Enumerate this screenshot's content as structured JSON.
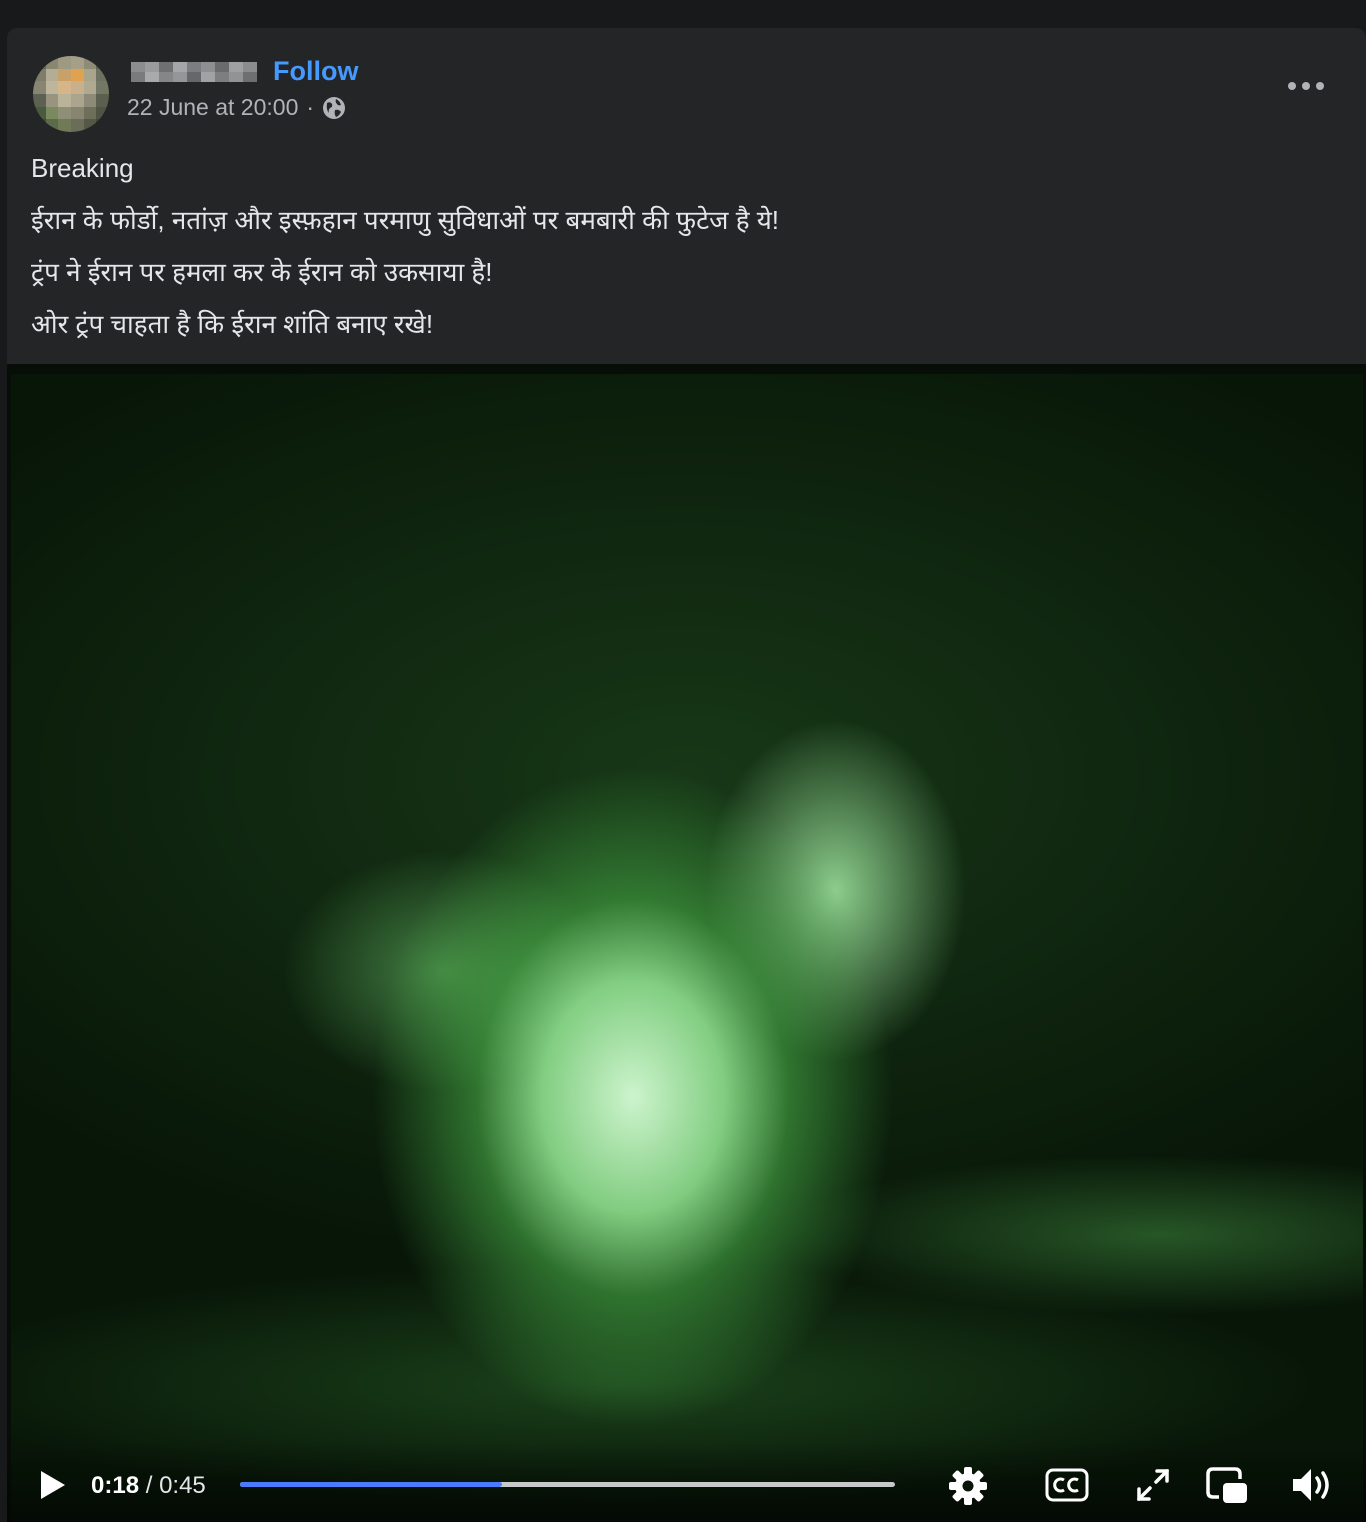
{
  "post": {
    "follow_label": "Follow",
    "timestamp": "22 June at 20:00",
    "separator": "·",
    "audience_icon": "globe-icon",
    "more_icon": "more-options-icon",
    "text_lines": [
      "Breaking",
      "ईरान के फोर्डो, नतांज़ और इस्फ़हान परमाणु सुविधाओं पर बमबारी की फुटेज है ये!",
      "ट्रंप ने ईरान पर हमला कर के ईरान को उकसाया है!",
      "ओर ट्रंप चाहता है कि ईरान शांति बनाए रखे!"
    ]
  },
  "video": {
    "current_time": "0:18",
    "time_separator": " / ",
    "duration": "0:45",
    "progress_fraction": 0.4,
    "icons": [
      "play-icon",
      "settings-icon",
      "closed-captions-icon",
      "fullscreen-icon",
      "picture-in-picture-icon",
      "volume-icon"
    ],
    "accent_color": "#4a7bff"
  },
  "colors": {
    "page_background": "#18191a",
    "card_background": "#242526",
    "follow_color": "#4599ff",
    "text_color": "#e4e6eb",
    "meta_color": "#b0b3b8"
  }
}
